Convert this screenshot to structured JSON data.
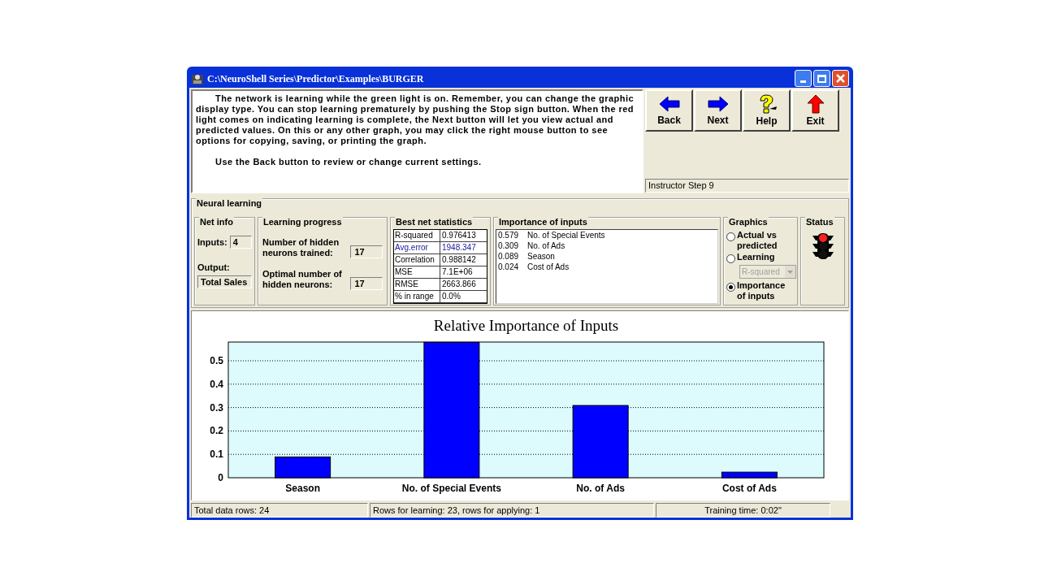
{
  "window": {
    "title": "C:\\NeuroShell Series\\Predictor\\Examples\\BURGER"
  },
  "instructions": {
    "paragraphs": [
      "The network is learning while the green light is on. Remember, you can change the graphic display type. You can stop learning prematurely by pushing the Stop sign button. When the red light comes on indicating learning is complete, the Next button will let you view actual and predicted values. On this or any other graph, you may click the right mouse button to see options for copying, saving, or printing the graph.",
      "Use the Back button to review or change current settings."
    ]
  },
  "nav_buttons": [
    {
      "kind": "back",
      "label": "Back"
    },
    {
      "kind": "next",
      "label": "Next"
    },
    {
      "kind": "help",
      "label": "Help"
    },
    {
      "kind": "exit",
      "label": "Exit"
    }
  ],
  "step": "Instructor Step 9",
  "neural_learning": {
    "title": "Neural learning",
    "net_info": {
      "title": "Net info",
      "inputs_label": "Inputs:",
      "inputs_value": "4",
      "output_label": "Output:",
      "output_value": "Total Sales"
    },
    "progress": {
      "title": "Learning progress",
      "trained_label": "Number of hidden neurons trained:",
      "trained_value": "17",
      "optimal_label": "Optimal number of hidden neurons:",
      "optimal_value": "17"
    },
    "stats": {
      "title": "Best net statistics",
      "rows": [
        {
          "name": "R-squared",
          "value": "0.976413",
          "selected": false
        },
        {
          "name": "Avg.error",
          "value": "1948.347",
          "selected": true
        },
        {
          "name": "Correlation",
          "value": "0.988142",
          "selected": false
        },
        {
          "name": "MSE",
          "value": "7.1E+06",
          "selected": false
        },
        {
          "name": "RMSE",
          "value": "2663.866",
          "selected": false
        },
        {
          "name": "% in range",
          "value": "0.0%",
          "selected": false
        }
      ]
    },
    "importance": {
      "title": "Importance of inputs",
      "rows": [
        {
          "value": "0.579",
          "name": "No. of Special Events"
        },
        {
          "value": "0.309",
          "name": "No. of Ads"
        },
        {
          "value": "0.089",
          "name": "Season"
        },
        {
          "value": "0.024",
          "name": "Cost of Ads"
        }
      ]
    },
    "graphics": {
      "title": "Graphics",
      "options": [
        {
          "label": "Actual vs predicted",
          "selected": false
        },
        {
          "label": "Learning",
          "selected": false
        },
        {
          "label": "Importance of inputs",
          "selected": true
        }
      ],
      "dropdown": {
        "value": "R-squared",
        "disabled": true
      }
    },
    "status": {
      "title": "Status",
      "lights": [
        {
          "on": true
        },
        {
          "on": false
        },
        {
          "on": false
        }
      ]
    }
  },
  "chart": {
    "chart_data": {
      "type": "bar",
      "title": "Relative Importance of Inputs",
      "categories": [
        "Season",
        "No. of Special Events",
        "No. of Ads",
        "Cost of Ads"
      ],
      "grid": true,
      "series": [
        {
          "color": "#0000ff",
          "values": [
            0.089,
            0.579,
            0.309,
            0.024
          ]
        }
      ],
      "ylim": [
        0,
        0.58
      ],
      "yticks": [
        0,
        0.1,
        0.2,
        0.3,
        0.4,
        0.5
      ]
    }
  },
  "status_bar": [
    "Total data rows: 24",
    "Rows for learning: 23, rows for applying: 1",
    "Training time: 0:02\""
  ]
}
